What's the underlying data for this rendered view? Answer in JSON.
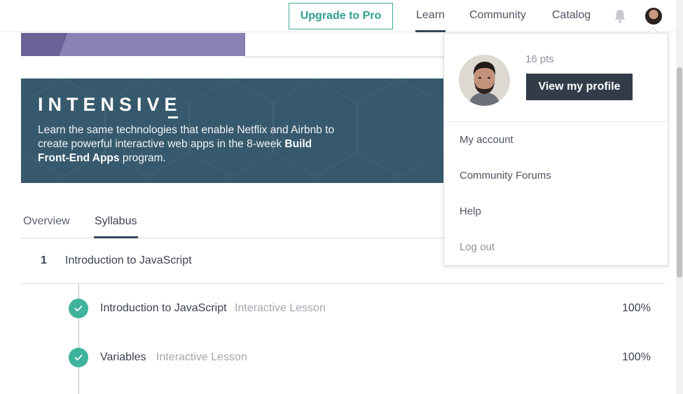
{
  "nav": {
    "upgrade_label": "Upgrade to Pro",
    "links": [
      "Learn",
      "Community",
      "Catalog"
    ],
    "active_link": "Learn",
    "icons": [
      "bell-icon",
      "user-avatar"
    ]
  },
  "banner": {
    "title": "INTENSIVE",
    "text_before": "Learn the same technologies that enable Netflix and Airbnb to create powerful interactive web apps in the 8-week ",
    "text_bold": "Build Front-End Apps",
    "text_after": " program."
  },
  "tabs": {
    "items": [
      "Overview",
      "Syllabus"
    ],
    "active": "Syllabus"
  },
  "module": {
    "number": "1",
    "title": "Introduction to JavaScript",
    "lessons": [
      {
        "name": "Introduction to JavaScript",
        "type": "Interactive Lesson",
        "progress": "100%",
        "completed": true
      },
      {
        "name": "Variables",
        "type": "Interactive Lesson",
        "progress": "100%",
        "completed": true
      }
    ]
  },
  "dropdown": {
    "points": "16 pts",
    "view_profile_label": "View my profile",
    "menu": [
      "My account",
      "Community Forums",
      "Help",
      "Log out"
    ]
  },
  "colors": {
    "accent_green": "#3fb39c",
    "banner_bg": "#36596d",
    "dark_button": "#323c49",
    "nav_underline": "#36485a"
  }
}
